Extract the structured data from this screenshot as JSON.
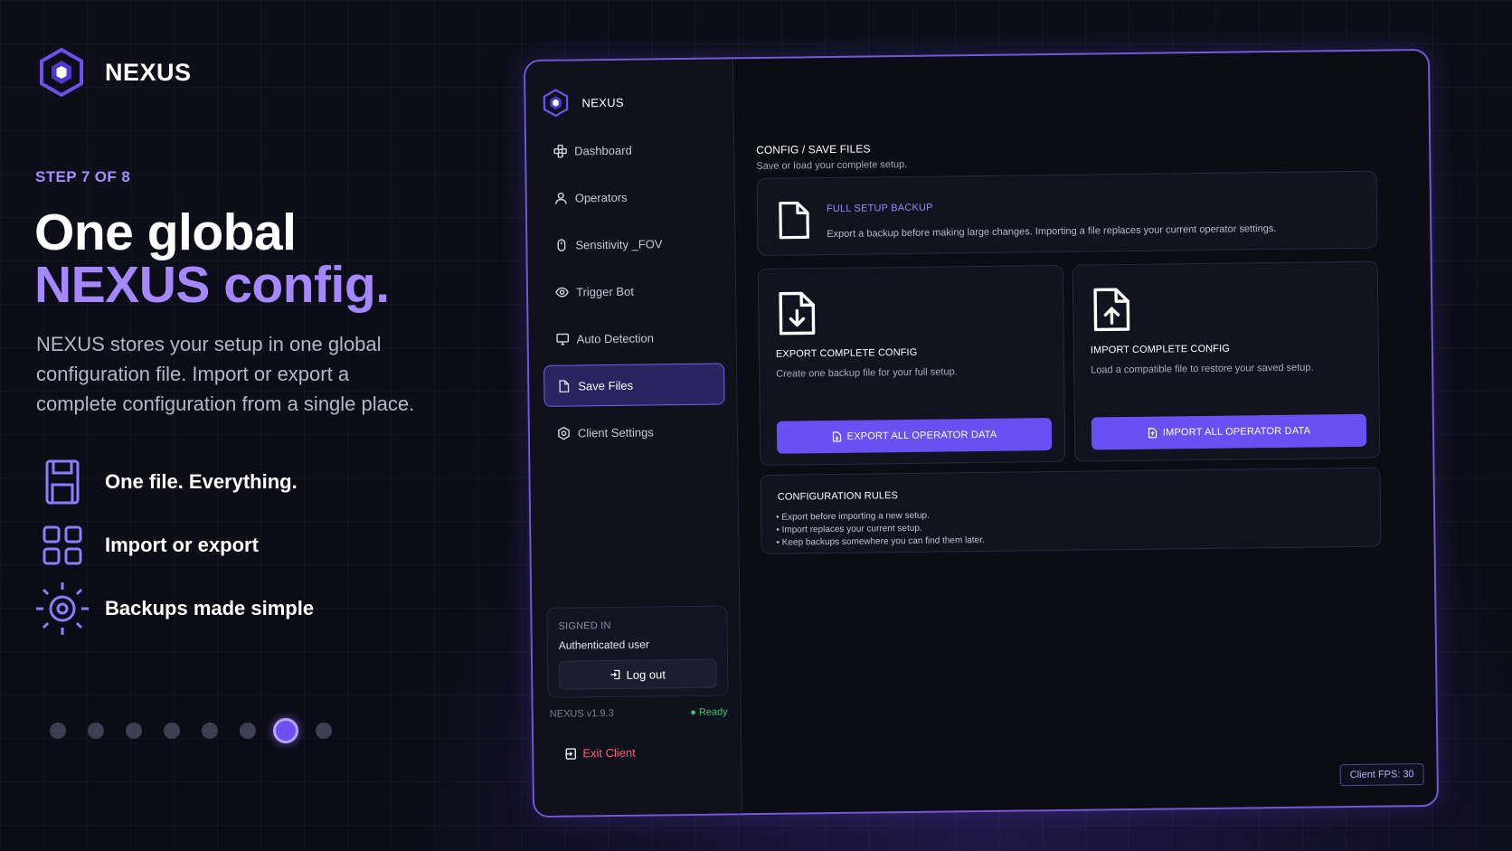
{
  "promo": {
    "brand": "NEXUS",
    "step": "STEP 7 OF 8",
    "headline_line1": "One global",
    "headline_line2": "NEXUS config.",
    "description": "NEXUS stores your setup in one global configuration file. Import or export a complete configuration from a single place.",
    "features": [
      {
        "label": "One file. Everything.",
        "icon": "floppy-disk-icon"
      },
      {
        "label": "Import or export",
        "icon": "grid-icon"
      },
      {
        "label": "Backups made simple",
        "icon": "sun-icon"
      }
    ],
    "pagination": {
      "total": 8,
      "active": 7
    }
  },
  "app": {
    "brand": "NEXUS",
    "nav": [
      {
        "label": "Dashboard",
        "icon": "dashboard-icon"
      },
      {
        "label": "Operators",
        "icon": "user-icon"
      },
      {
        "label": "Sensitivity _FOV",
        "icon": "mouse-icon"
      },
      {
        "label": "Trigger Bot",
        "icon": "eye-icon"
      },
      {
        "label": "Auto Detection",
        "icon": "monitor-icon"
      },
      {
        "label": "Save Files",
        "icon": "file-icon",
        "active": true
      },
      {
        "label": "Client Settings",
        "icon": "settings-icon"
      }
    ],
    "signin": {
      "label": "SIGNED IN",
      "user": "Authenticated user",
      "logout": "Log out"
    },
    "version": "NEXUS v1.9.3",
    "status": "● Ready",
    "exit": "Exit Client",
    "breadcrumb": "CONFIG / SAVE FILES",
    "breadcrumb_sub": "Save or load your complete setup.",
    "backup": {
      "title": "FULL SETUP BACKUP",
      "text": "Export a backup before making large changes. Importing a file replaces your current operator settings."
    },
    "export": {
      "title": "EXPORT COMPLETE CONFIG",
      "text": "Create one backup file for your full setup.",
      "button": "EXPORT ALL OPERATOR DATA"
    },
    "import": {
      "title": "IMPORT COMPLETE CONFIG",
      "text": "Load a compatible file to restore your saved setup.",
      "button": "IMPORT ALL OPERATOR DATA"
    },
    "rules": {
      "title": "CONFIGURATION RULES",
      "items": [
        "• Export before importing a new setup.",
        "• Import replaces your current setup.",
        "• Keep backups somewhere you can find them later."
      ]
    },
    "fps": "Client FPS: 30"
  },
  "colors": {
    "accent": "#6a4ff2",
    "accent_light": "#a587ff",
    "ready": "#39c27a",
    "exit": "#ff5b7a"
  }
}
